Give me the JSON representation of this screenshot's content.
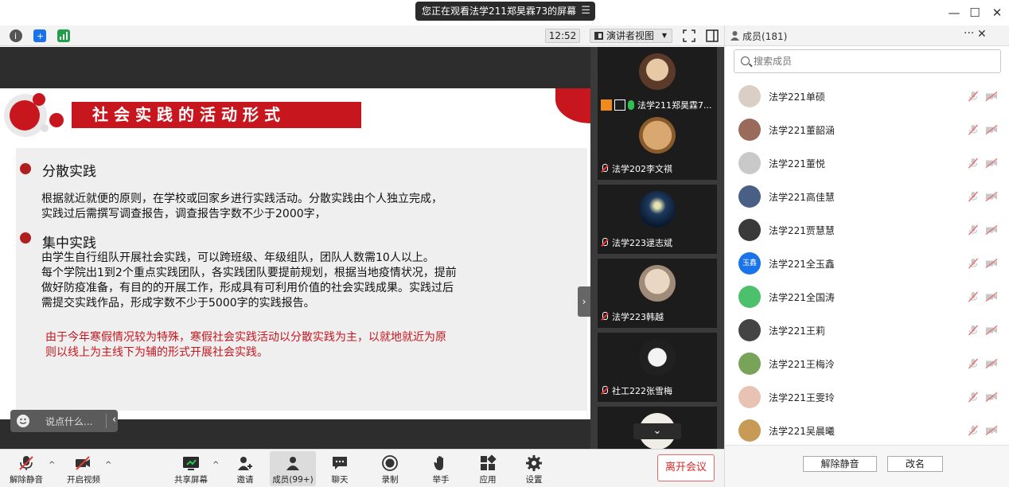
{
  "banner": {
    "text": "您正在观看法学211郑昊霖73的屏幕",
    "menu_icon": "menu-icon"
  },
  "infobar": {
    "time": "12:52",
    "view_mode": "演讲者视图"
  },
  "slide": {
    "title": "社会实践的活动形式",
    "sections": [
      {
        "heading": "分散实践",
        "lines": [
          "根据就近就便的原则，在学校或回家乡进行实践活动。分散实践由个人独立完成，",
          "实践过后需撰写调查报告，调查报告字数不少于2000字，"
        ]
      },
      {
        "heading": "集中实践",
        "lines": [
          "由学生自行组队开展社会实践，可以跨班级、年级组队，团队人数需10人以上。",
          "每个学院出1到2个重点实践团队，各实践团队要提前规划，根据当地疫情状况，提前",
          "做好防疫准备，有目的的开展工作，形成具有可利用价值的社会实践成果。实践过后",
          "需提交实践作品，形成字数不少于5000字的实践报告。"
        ]
      }
    ],
    "note_lines": [
      "由于今年寒假情况较为特殊，寒假社会实践活动以分散实践为主，以就地就近为原",
      "则以线上为主线下为辅的形式开展社会实践。"
    ]
  },
  "chat": {
    "placeholder": "说点什么..."
  },
  "video_tiles": [
    {
      "name": "法学211郑昊霖7..."
    },
    {
      "name": "法学202李文祺"
    },
    {
      "name": "法学223逯志斌"
    },
    {
      "name": "法学223韩越"
    },
    {
      "name": "社工222张雪梅"
    },
    {
      "name": ""
    }
  ],
  "members": {
    "title": "成员(181)",
    "search_placeholder": "搜索成员",
    "list": [
      {
        "name": "法学221单硕",
        "avatar_color": "#d9cfc4",
        "avatar_text": ""
      },
      {
        "name": "法学221董韶涵",
        "avatar_color": "#9a6b5a",
        "avatar_text": ""
      },
      {
        "name": "法学221董悦",
        "avatar_color": "#c9c9c9",
        "avatar_text": ""
      },
      {
        "name": "法学221高佳慧",
        "avatar_color": "#4a5f86",
        "avatar_text": ""
      },
      {
        "name": "法学221贾慧慧",
        "avatar_color": "#3a3a3a",
        "avatar_text": ""
      },
      {
        "name": "法学221全玉鑫",
        "avatar_color": "#1a73e8",
        "avatar_text": "玉鑫"
      },
      {
        "name": "法学221全国涛",
        "avatar_color": "#4cc06a",
        "avatar_text": ""
      },
      {
        "name": "法学221王莉",
        "avatar_color": "#444444",
        "avatar_text": ""
      },
      {
        "name": "法学221王梅泠",
        "avatar_color": "#7aa35a",
        "avatar_text": ""
      },
      {
        "name": "法学221王雯玲",
        "avatar_color": "#e8c3b4",
        "avatar_text": ""
      },
      {
        "name": "法学221吴晨曦",
        "avatar_color": "#c79a55",
        "avatar_text": ""
      }
    ],
    "unmute_btn": "解除静音",
    "rename_btn": "改名"
  },
  "toolbar": {
    "unmute": "解除静音",
    "start_video": "开启视频",
    "share": "共享屏幕",
    "invite": "邀请",
    "members": "成员(99+)",
    "chat": "聊天",
    "record": "录制",
    "raise_hand": "举手",
    "apps": "应用",
    "settings": "设置",
    "leave": "离开会议"
  },
  "colors": {
    "accent_red": "#c8161e",
    "dark_bg": "#2d2d2d",
    "panel_bg": "#efefef"
  }
}
